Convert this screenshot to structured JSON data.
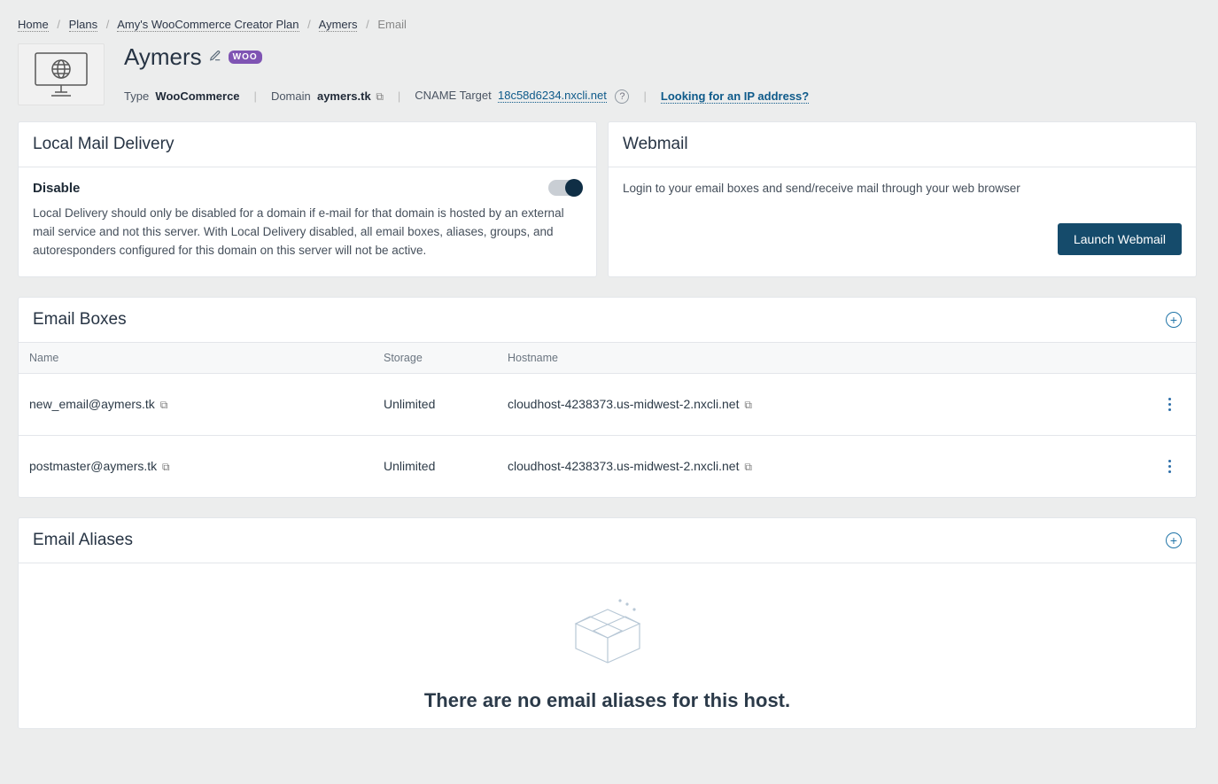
{
  "breadcrumb": {
    "home": "Home",
    "plans": "Plans",
    "plan_name": "Amy's WooCommerce Creator Plan",
    "site": "Aymers",
    "current": "Email"
  },
  "header": {
    "title": "Aymers",
    "type_label": "Type",
    "type_value": "WooCommerce",
    "domain_label": "Domain",
    "domain_value": "aymers.tk",
    "cname_label": "CNAME Target",
    "cname_value": "18c58d6234.nxcli.net",
    "ip_link": "Looking for an IP address?",
    "woo_badge": "WOO"
  },
  "local_mail": {
    "title": "Local Mail Delivery",
    "disable_label": "Disable",
    "description": "Local Delivery should only be disabled for a domain if e-mail for that domain is hosted by an external mail service and not this server. With Local Delivery disabled, all email boxes, aliases, groups, and autoresponders configured for this domain on this server will not be active."
  },
  "webmail": {
    "title": "Webmail",
    "description": "Login to your email boxes and send/receive mail through your web browser",
    "button": "Launch Webmail"
  },
  "email_boxes": {
    "title": "Email Boxes",
    "columns": {
      "name": "Name",
      "storage": "Storage",
      "hostname": "Hostname"
    },
    "rows": [
      {
        "name": "new_email@aymers.tk",
        "storage": "Unlimited",
        "hostname": "cloudhost-4238373.us-midwest-2.nxcli.net"
      },
      {
        "name": "postmaster@aymers.tk",
        "storage": "Unlimited",
        "hostname": "cloudhost-4238373.us-midwest-2.nxcli.net"
      }
    ]
  },
  "email_aliases": {
    "title": "Email Aliases",
    "empty_message": "There are no email aliases for this host."
  }
}
